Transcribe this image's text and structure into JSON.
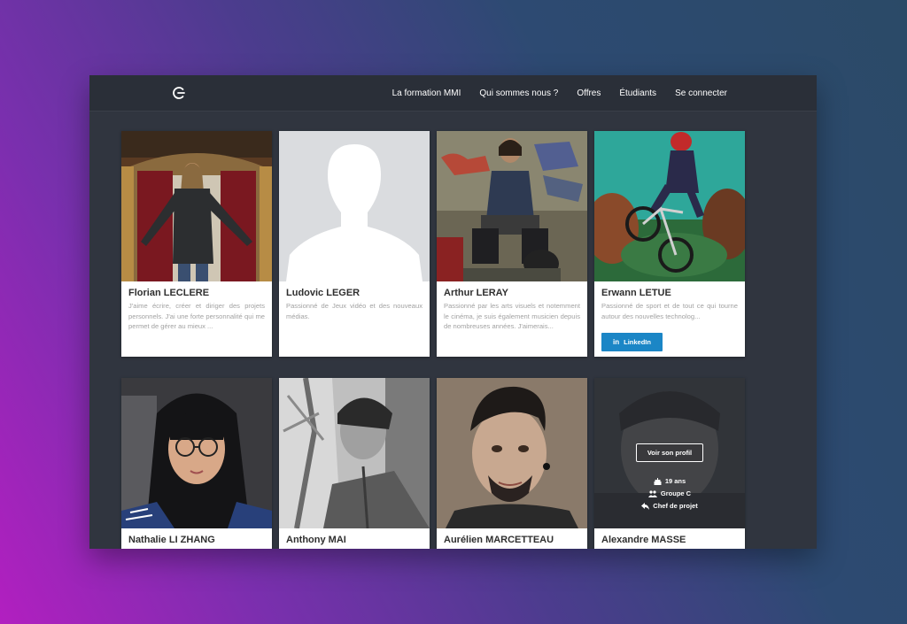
{
  "nav": {
    "logo": "logo-icon",
    "links": [
      "La formation MMI",
      "Qui sommes nous ?",
      "Offres",
      "Étudiants",
      "Se connecter"
    ]
  },
  "cards": [
    {
      "name": "Florian LECLERE",
      "desc": "J'aime écrire, créer et diriger des projets personnels. J'ai une forte personnalité qui me permet de gérer au mieux ..."
    },
    {
      "name": "Ludovic LEGER",
      "desc": "Passionné de Jeux vidéo et des nouveaux médias."
    },
    {
      "name": "Arthur LERAY",
      "desc": "Passionné par les arts visuels et notemment le cinéma, je suis également musicien depuis de nombreuses années. J'aimerais..."
    },
    {
      "name": "Erwann LETUE",
      "desc": "Passionné de sport et de tout ce qui tourne autour des nouvelles technolog...",
      "button": "LinkedIn"
    },
    {
      "name": "Nathalie LI ZHANG"
    },
    {
      "name": "Anthony MAI"
    },
    {
      "name": "Aurélien MARCETTEAU"
    },
    {
      "name": "Alexandre MASSE",
      "overlay": {
        "button": "Voir son profil",
        "age": "19 ans",
        "group": "Groupe C",
        "role": "Chef de projet"
      }
    }
  ],
  "colors": {
    "accent": "#1b86c6",
    "navbar": "#2a2f38",
    "panel": "#30353f"
  }
}
